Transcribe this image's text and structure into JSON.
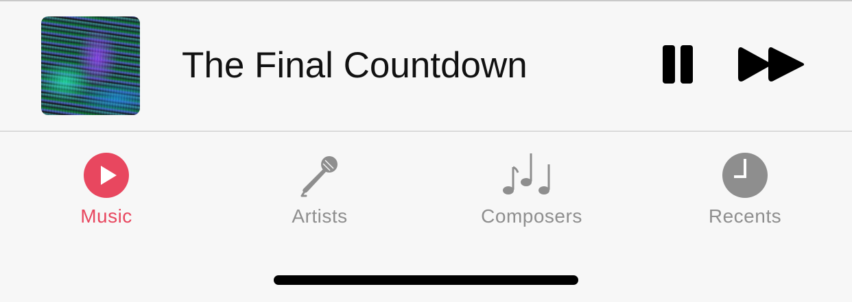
{
  "now_playing": {
    "title": "The Final Countdown",
    "artwork_icon": "album-artwork",
    "pause_icon": "pause-icon",
    "forward_icon": "fast-forward-icon"
  },
  "tab_bar": {
    "active_color": "#e8475f",
    "inactive_color": "#8e8e8e",
    "items": [
      {
        "label": "Music",
        "icon": "play-circle-icon",
        "active": true
      },
      {
        "label": "Artists",
        "icon": "microphone-icon",
        "active": false
      },
      {
        "label": "Composers",
        "icon": "music-notes-icon",
        "active": false
      },
      {
        "label": "Recents",
        "icon": "clock-icon",
        "active": false
      }
    ]
  }
}
